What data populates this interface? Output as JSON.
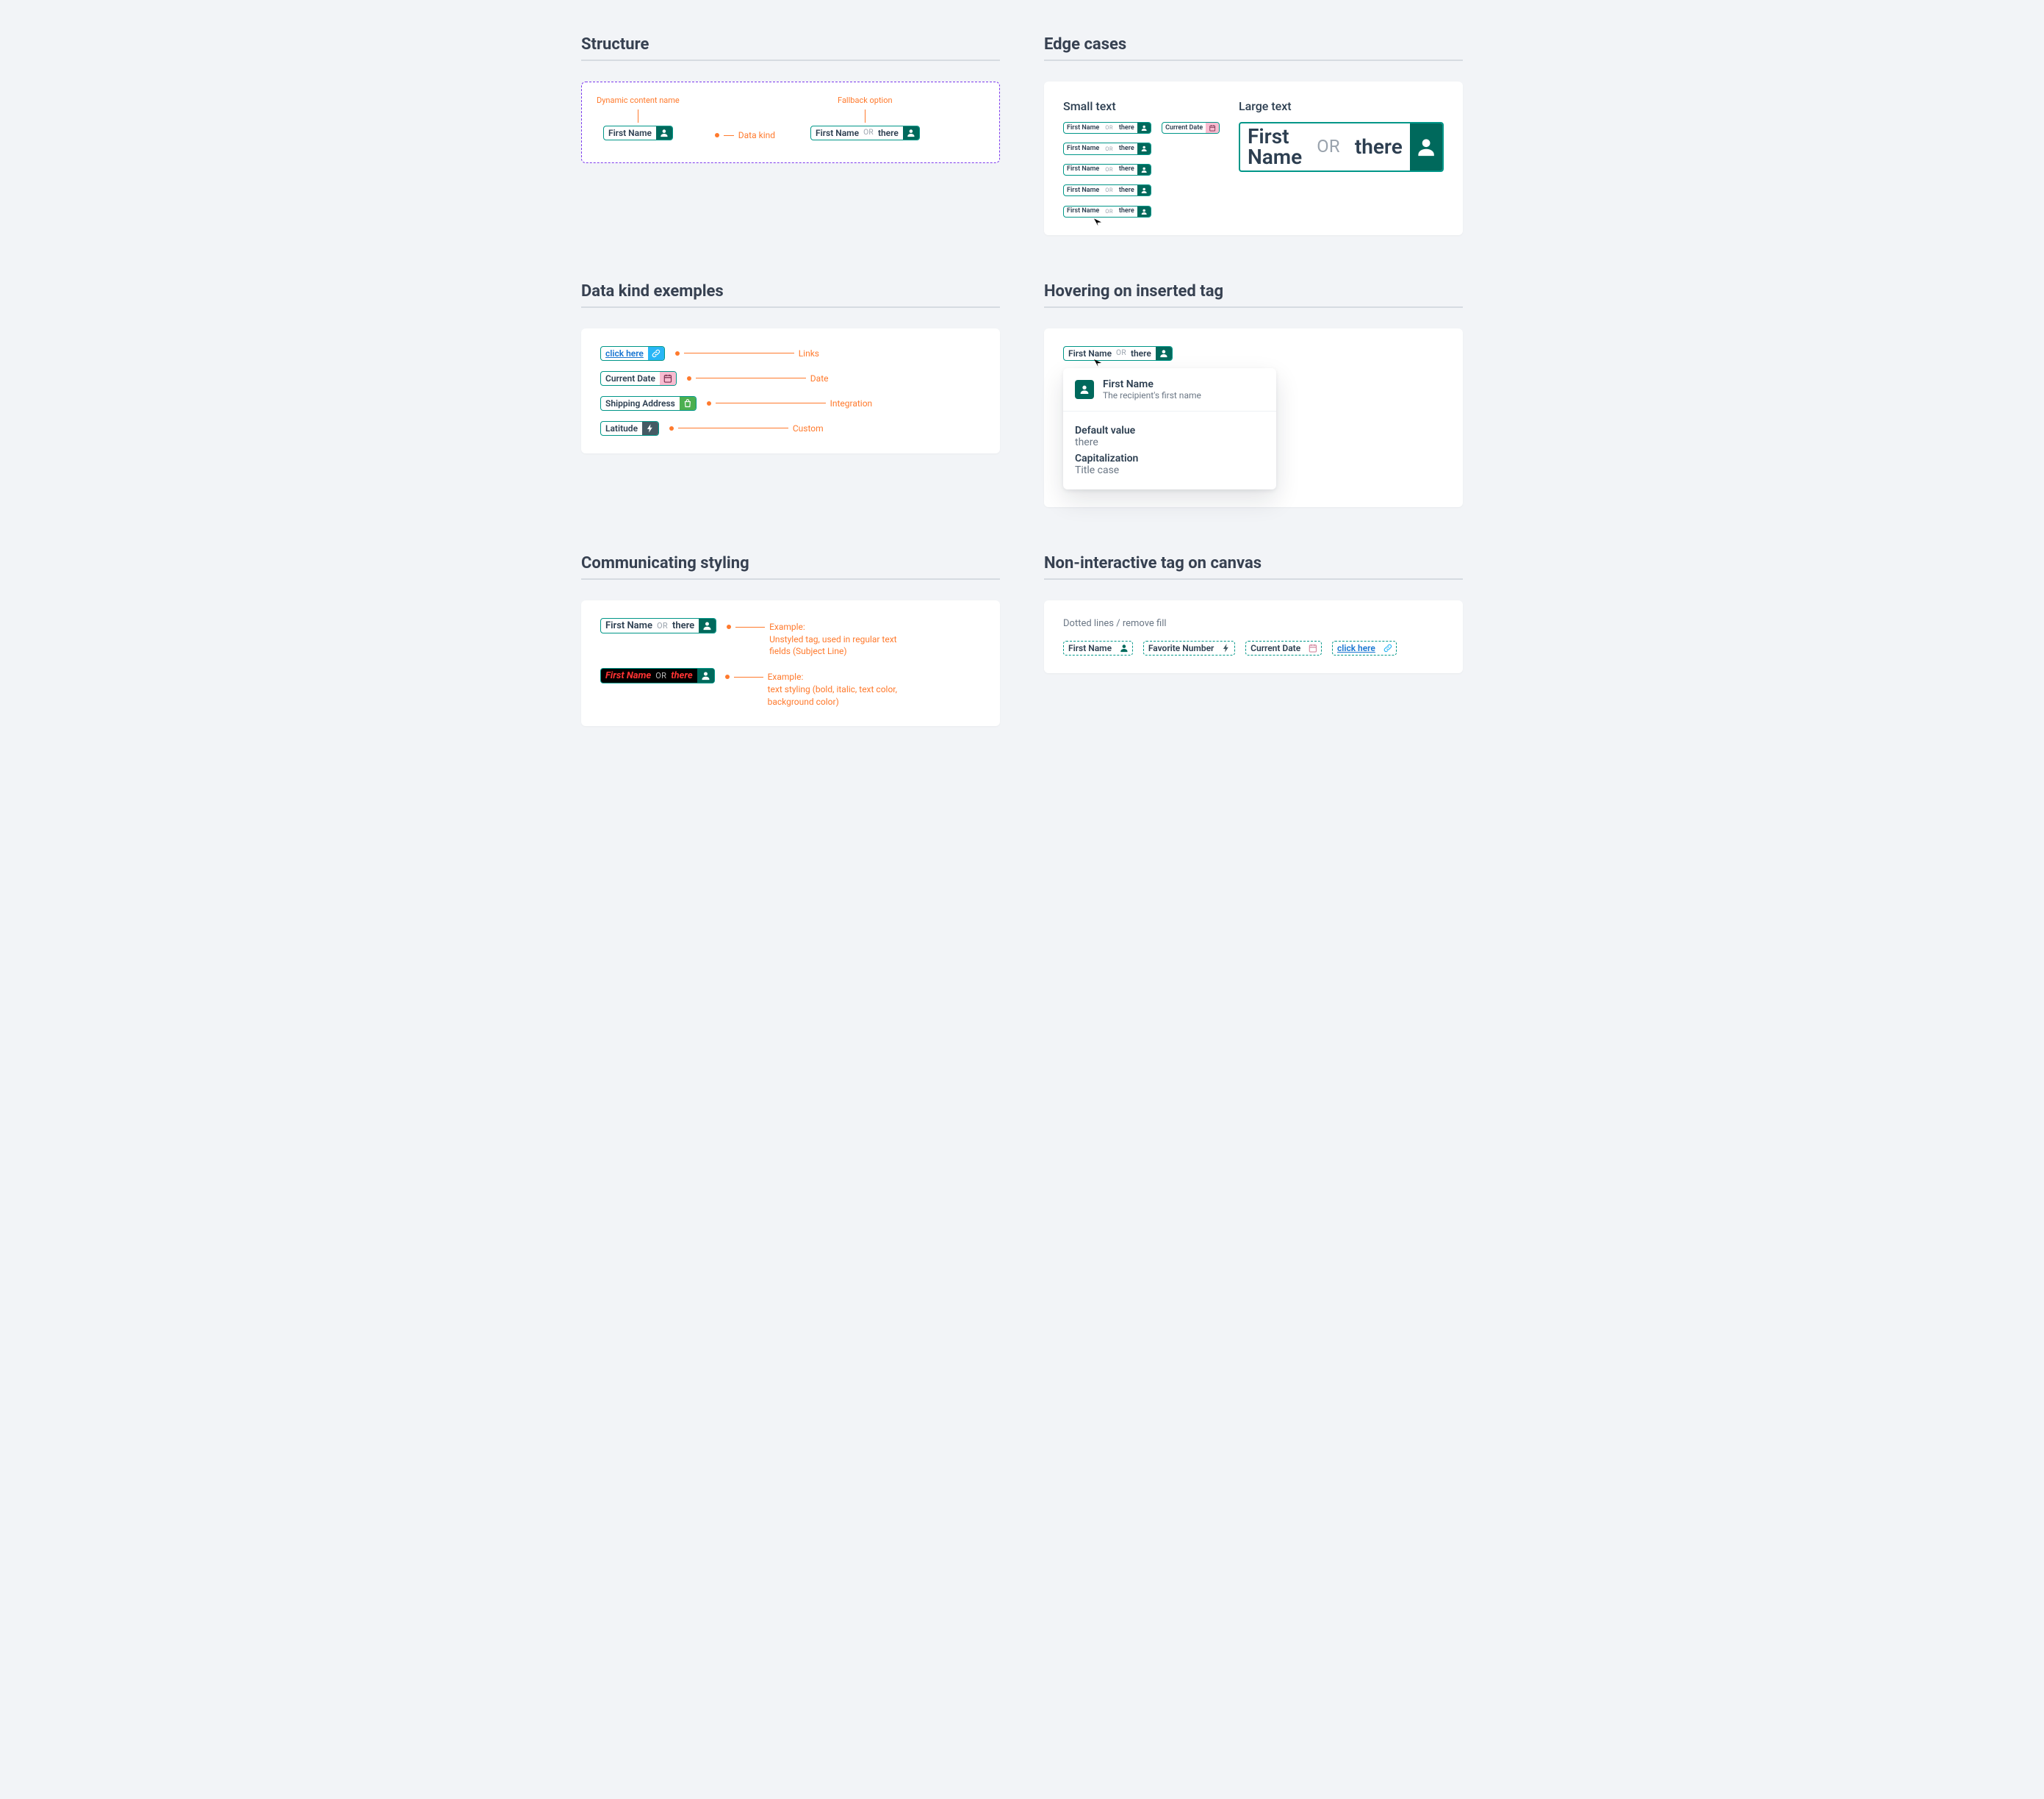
{
  "sections": {
    "structure": {
      "title": "Structure"
    },
    "edge": {
      "title": "Edge cases",
      "small": "Small text",
      "large": "Large text"
    },
    "datakind": {
      "title": "Data kind exemples"
    },
    "hover": {
      "title": "Hovering on inserted tag"
    },
    "styling": {
      "title": "Communicating styling"
    },
    "noninteractive": {
      "title": "Non-interactive tag on canvas",
      "note": "Dotted lines / remove fill"
    }
  },
  "structure": {
    "labels": {
      "dynamic": "Dynamic content name",
      "fallback": "Fallback option",
      "kind": "Data kind"
    },
    "tag1": {
      "name": "First Name"
    },
    "tag2": {
      "name": "First Name",
      "or": "OR",
      "fallback": "there"
    }
  },
  "datakind": {
    "items": [
      {
        "text": "click here",
        "kind": "link",
        "label": "Links"
      },
      {
        "text": "Current Date",
        "kind": "date",
        "label": "Date"
      },
      {
        "text": "Shipping Address",
        "kind": "integ",
        "label": "Integration"
      },
      {
        "text": "Latitude",
        "kind": "custom",
        "label": "Custom"
      }
    ]
  },
  "edge": {
    "small": [
      {
        "name": "First Name",
        "or": "OR",
        "fallback": "there",
        "kind": "user"
      },
      {
        "name": "Current Date",
        "kind": "date"
      },
      {
        "name": "First Name",
        "or": "OR",
        "fallback": "there",
        "kind": "user",
        "dot": true
      },
      {
        "name": "First Name",
        "or": "OR",
        "fallback": "there",
        "kind": "user",
        "dot": true
      },
      {
        "name": "First Name",
        "or": "OR",
        "fallback": "there",
        "kind": "user"
      },
      {
        "name": "First Name",
        "or": "OR",
        "fallback": "there",
        "kind": "user"
      }
    ],
    "large": {
      "name": "First Name",
      "or": "OR",
      "fallback": "there",
      "kind": "user"
    }
  },
  "hover": {
    "tag": {
      "name": "First Name",
      "or": "OR",
      "fallback": "there"
    },
    "popover": {
      "title": "First Name",
      "subtitle": "The recipient's first name",
      "default_label": "Default value",
      "default_value": "there",
      "cap_label": "Capitalization",
      "cap_value": "Title case"
    }
  },
  "styling": {
    "examples": [
      {
        "name": "First Name",
        "or": "OR",
        "fallback": "there",
        "label1": "Example:",
        "label2": "Unstyled tag, used in regular text fields (Subject Line)",
        "variant": "plain"
      },
      {
        "name": "First Name",
        "or": "OR",
        "fallback": "there",
        "label1": "Example:",
        "label2": "text styling (bold, italic, text color, background color)",
        "variant": "styled"
      }
    ]
  },
  "noninteractive": {
    "tags": [
      {
        "text": "First Name",
        "kind": "user"
      },
      {
        "text": "Favorite Number",
        "kind": "custom"
      },
      {
        "text": "Current Date",
        "kind": "date"
      },
      {
        "text": "click here",
        "kind": "link"
      }
    ]
  }
}
